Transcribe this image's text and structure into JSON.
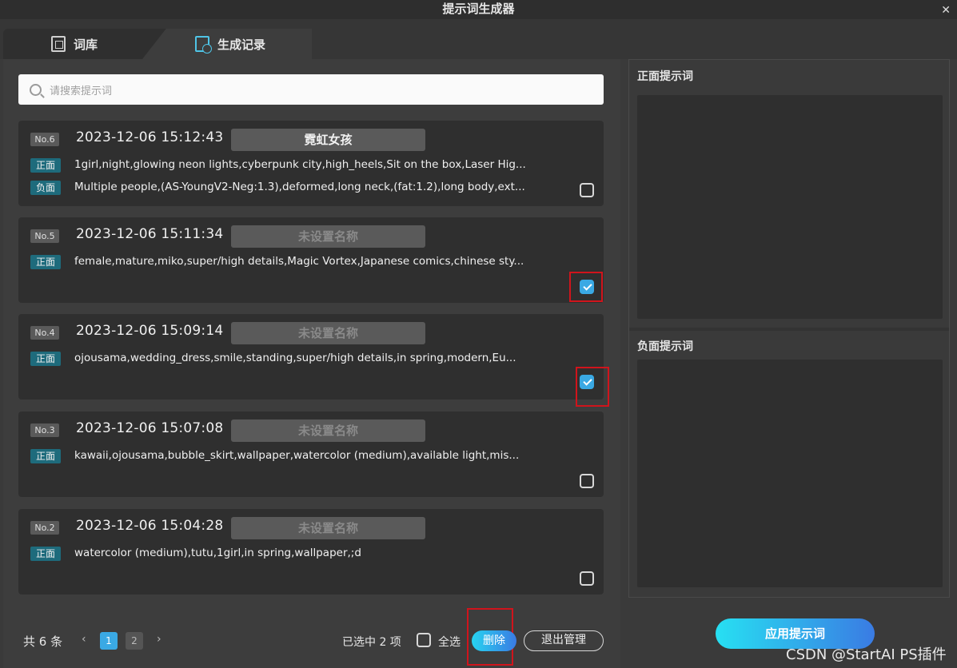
{
  "window": {
    "title": "提示词生成器",
    "close_label": "✕"
  },
  "tabs": [
    {
      "label": "词库",
      "icon": "dictionary-icon"
    },
    {
      "label": "生成记录",
      "icon": "history-icon"
    }
  ],
  "search": {
    "placeholder": "请搜索提示词"
  },
  "records": [
    {
      "no": "No.6",
      "timestamp": "2023-12-06 15:12:43",
      "name": "霓虹女孩",
      "positive_tag": "正面",
      "positive": "1girl,night,glowing neon lights,cyberpunk city,high_heels,Sit on the box,Laser Hig...",
      "negative_tag": "负面",
      "negative": "Multiple people,(AS-YoungV2-Neg:1.3),deformed,long neck,(fat:1.2),long body,ext...",
      "checked": false
    },
    {
      "no": "No.5",
      "timestamp": "2023-12-06 15:11:34",
      "name": "未设置名称",
      "positive_tag": "正面",
      "positive": "female,mature,miko,super/high details,Magic Vortex,Japanese comics,chinese sty...",
      "checked": true
    },
    {
      "no": "No.4",
      "timestamp": "2023-12-06 15:09:14",
      "name": "未设置名称",
      "positive_tag": "正面",
      "positive": "ojousama,wedding_dress,smile,standing,super/high details,in spring,modern,Eu...",
      "checked": true
    },
    {
      "no": "No.3",
      "timestamp": "2023-12-06 15:07:08",
      "name": "未设置名称",
      "positive_tag": "正面",
      "positive": "kawaii,ojousama,bubble_skirt,wallpaper,watercolor (medium),available light,mis...",
      "checked": false
    },
    {
      "no": "No.2",
      "timestamp": "2023-12-06 15:04:28",
      "name": "未设置名称",
      "positive_tag": "正面",
      "positive": "watercolor (medium),tutu,1girl,in spring,wallpaper,;d",
      "checked": false
    }
  ],
  "footer": {
    "total": "共 6 条",
    "prev": "‹",
    "next": "›",
    "pages": [
      "1",
      "2"
    ],
    "current_page": "1",
    "selected": "已选中 2 项",
    "select_all": "全选",
    "delete": "删除",
    "exit_manage": "退出管理"
  },
  "right_panel": {
    "positive_title": "正面提示词",
    "negative_title": "负面提示词",
    "apply": "应用提示词"
  },
  "watermark": "CSDN @StartAI PS插件",
  "colors": {
    "accent": "#3aa9e4",
    "tag": "#1e6b7c",
    "highlight_box": "#d0141c"
  }
}
